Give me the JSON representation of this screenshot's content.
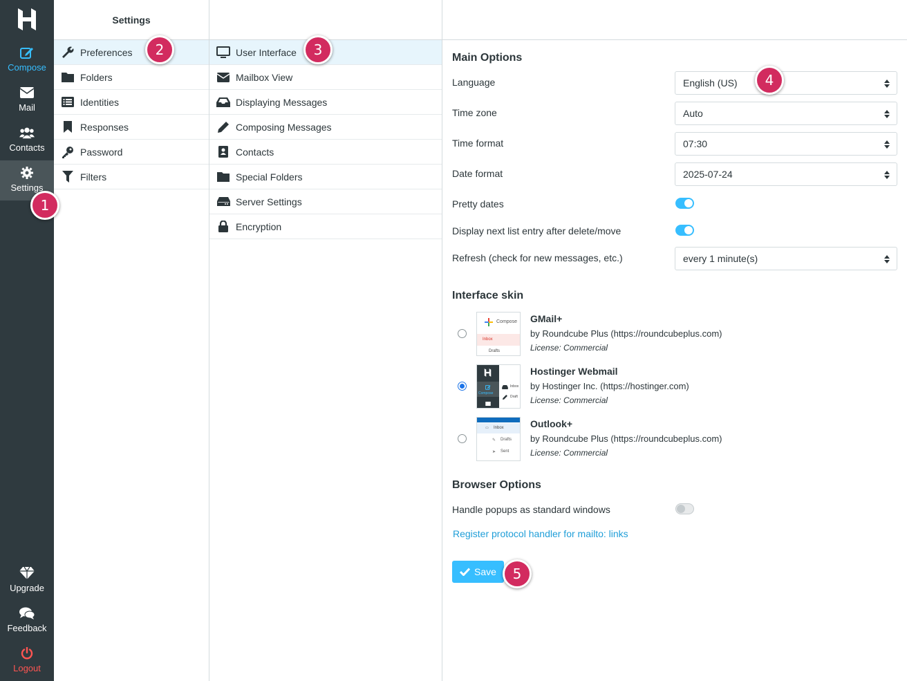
{
  "rail": {
    "items": [
      {
        "label": "Compose",
        "icon": "compose-icon"
      },
      {
        "label": "Mail",
        "icon": "mail-icon"
      },
      {
        "label": "Contacts",
        "icon": "contacts-icon"
      },
      {
        "label": "Settings",
        "icon": "gear-icon"
      }
    ],
    "bottom": [
      {
        "label": "Upgrade",
        "icon": "diamond-icon"
      },
      {
        "label": "Feedback",
        "icon": "chat-icon"
      },
      {
        "label": "Logout",
        "icon": "power-icon"
      }
    ]
  },
  "settings_column": {
    "title": "Settings",
    "items": [
      {
        "label": "Preferences",
        "icon": "wrench-icon"
      },
      {
        "label": "Folders",
        "icon": "folder-icon"
      },
      {
        "label": "Identities",
        "icon": "id-list-icon"
      },
      {
        "label": "Responses",
        "icon": "bookmark-icon"
      },
      {
        "label": "Password",
        "icon": "key-icon"
      },
      {
        "label": "Filters",
        "icon": "filter-icon"
      }
    ]
  },
  "sections_column": {
    "items": [
      {
        "label": "User Interface",
        "icon": "monitor-icon"
      },
      {
        "label": "Mailbox View",
        "icon": "envelope-icon"
      },
      {
        "label": "Displaying Messages",
        "icon": "inbox-icon"
      },
      {
        "label": "Composing Messages",
        "icon": "pencil-icon"
      },
      {
        "label": "Contacts",
        "icon": "address-book-icon"
      },
      {
        "label": "Special Folders",
        "icon": "folder-icon"
      },
      {
        "label": "Server Settings",
        "icon": "server-icon"
      },
      {
        "label": "Encryption",
        "icon": "lock-icon"
      }
    ]
  },
  "main": {
    "main_options": {
      "title": "Main Options",
      "language_label": "Language",
      "language_value": "English (US)",
      "timezone_label": "Time zone",
      "timezone_value": "Auto",
      "timeformat_label": "Time format",
      "timeformat_value": "07:30",
      "dateformat_label": "Date format",
      "dateformat_value": "2025-07-24",
      "prettydates_label": "Pretty dates",
      "prettydates_on": true,
      "nextentry_label": "Display next list entry after delete/move",
      "nextentry_on": true,
      "refresh_label": "Refresh (check for new messages, etc.)",
      "refresh_value": "every 1 minute(s)"
    },
    "skin": {
      "title": "Interface skin",
      "skins": [
        {
          "name": "GMail+",
          "author": "by Roundcube Plus (https://roundcubeplus.com)",
          "license_prefix": "License: ",
          "license": "Commercial",
          "selected": false,
          "thumb": {
            "compose": "Compose",
            "inbox": "Inbox",
            "drafts": "Drafts"
          }
        },
        {
          "name": "Hostinger Webmail",
          "author": "by Hostinger Inc. (https://hostinger.com)",
          "license_prefix": "License: ",
          "license": "Commercial",
          "selected": true,
          "thumb": {
            "compose": "Compose",
            "inbox": "Inbox",
            "drafts": "Draft"
          }
        },
        {
          "name": "Outlook+",
          "author": "by Roundcube Plus (https://roundcubeplus.com)",
          "license_prefix": "License: ",
          "license": "Commercial",
          "selected": false,
          "thumb": {
            "inbox": "Inbox",
            "drafts": "Drafts",
            "sent": "Sent"
          }
        }
      ]
    },
    "browser": {
      "title": "Browser Options",
      "popups_label": "Handle popups as standard windows",
      "popups_on": false,
      "protocol_link": "Register protocol handler for mailto: links"
    },
    "save_label": "Save"
  },
  "badges": [
    "1",
    "2",
    "3",
    "4",
    "5"
  ],
  "colors": {
    "accent": "#37beff",
    "rail": "#2f3a3f",
    "badge": "#d22b5f",
    "logout": "#ff5552"
  }
}
